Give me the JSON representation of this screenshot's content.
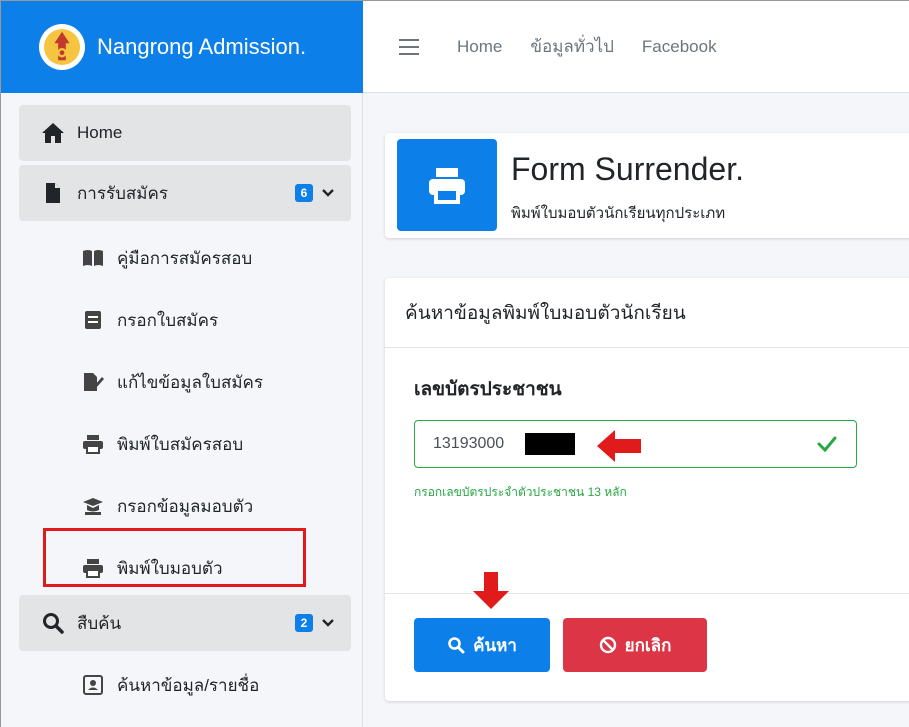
{
  "brand": {
    "title": "Nangrong Admission."
  },
  "topbar": {
    "links": [
      "Home",
      "ข้อมูลทั่วไป",
      "Facebook"
    ]
  },
  "sidebar": {
    "home": "Home",
    "admission": {
      "label": "การรับสมัคร",
      "badge": "6"
    },
    "admission_items": [
      "คู่มือการสมัครสอบ",
      "กรอกใบสมัคร",
      "แก้ไขข้อมูลใบสมัคร",
      "พิมพ์ใบสมัครสอบ",
      "กรอกข้อมูลมอบตัว",
      "พิมพ์ใบมอบตัว"
    ],
    "search": {
      "label": "สืบค้น",
      "badge": "2"
    },
    "search_items": [
      "ค้นหาข้อมูล/รายชื่อ"
    ]
  },
  "info_box": {
    "title": "Form Surrender.",
    "subtitle": "พิมพ์ใบมอบตัวนักเรียนทุกประเภท"
  },
  "card": {
    "header": "ค้นหาข้อมูลพิมพ์ใบมอบตัวนักเรียน",
    "field_label": "เลขบัตรประชาชน",
    "input_value": "13193000",
    "help_text": "กรอกเลขบัตรประจำตัวประชาชน 13 หลัก",
    "search_button": "ค้นหา",
    "cancel_button": "ยกเลิก"
  },
  "colors": {
    "primary": "#0d7fe8",
    "success": "#28a745",
    "danger": "#dc3545",
    "annotation": "#e11b1b"
  }
}
